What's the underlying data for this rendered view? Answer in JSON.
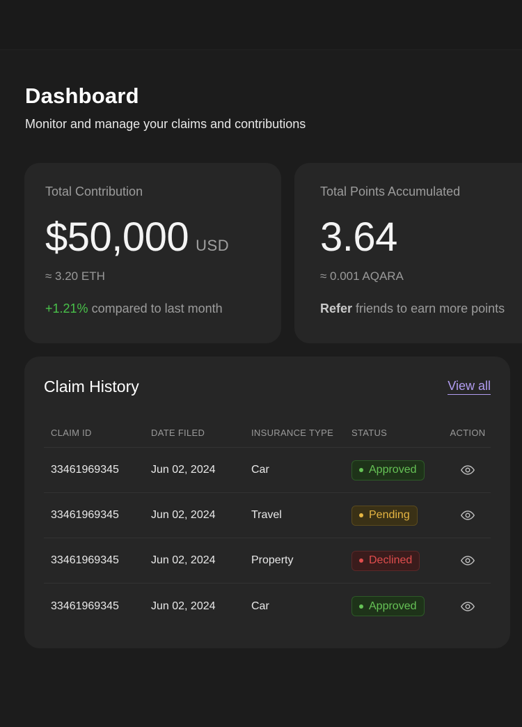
{
  "header": {
    "title": "Dashboard",
    "subtitle": "Monitor and manage your claims and contributions"
  },
  "contribution": {
    "label": "Total Contribution",
    "value": "$50,000",
    "unit": "USD",
    "conversion": "≈ 3.20 ETH",
    "trend": "+1.21%",
    "trend_text": " compared to last month"
  },
  "points": {
    "label": "Total Points Accumulated",
    "value": "3.64",
    "conversion": "≈ 0.001 AQARA",
    "refer_label": "Refer",
    "refer_text": " friends to earn more points"
  },
  "claims": {
    "title": "Claim History",
    "view_all": "View all",
    "columns": [
      "CLAIM ID",
      "DATE FILED",
      "INSURANCE TYPE",
      "STATUS",
      "ACTION"
    ],
    "rows": [
      {
        "id": "33461969345",
        "date": "Jun 02, 2024",
        "type": "Car",
        "status": "Approved"
      },
      {
        "id": "33461969345",
        "date": "Jun 02, 2024",
        "type": "Travel",
        "status": "Pending"
      },
      {
        "id": "33461969345",
        "date": "Jun 02, 2024",
        "type": "Property",
        "status": "Declined"
      },
      {
        "id": "33461969345",
        "date": "Jun 02, 2024",
        "type": "Car",
        "status": "Approved"
      }
    ]
  },
  "colors": {
    "accent": "#b19cf0",
    "trend_up": "#49c24a",
    "approved": "#66c256",
    "pending": "#e5b542",
    "declined": "#e04d4d"
  },
  "icons": {
    "action": "eye-icon"
  }
}
